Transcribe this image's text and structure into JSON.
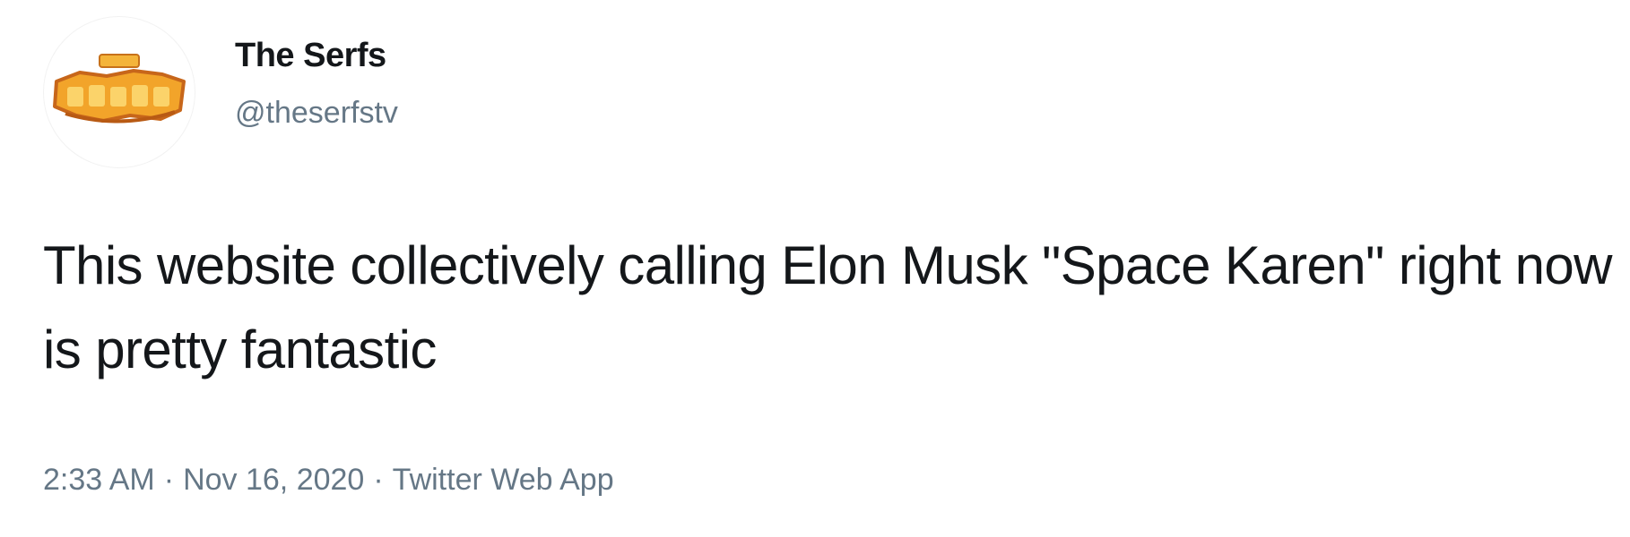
{
  "tweet": {
    "author": {
      "display_name": "The Serfs",
      "handle": "@theserfstv",
      "avatar_icon": "the-serfs-logo-avatar"
    },
    "text": "This website collectively calling Elon Musk \"Space Karen\" right now is pretty fantastic",
    "meta": {
      "time": "2:33 AM",
      "separator": "·",
      "date": "Nov 16, 2020",
      "source": "Twitter Web App"
    },
    "colors": {
      "text": "#14171a",
      "secondary": "#657786",
      "logo_orange": "#f0a020"
    }
  }
}
